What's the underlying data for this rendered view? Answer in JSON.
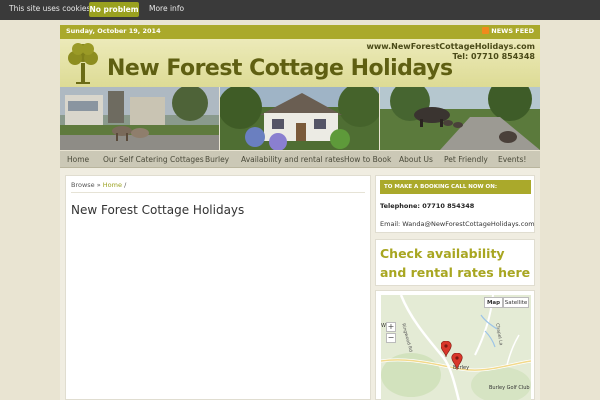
{
  "cookie_bar": {
    "message": "This site uses cookies",
    "accept_label": "No problem",
    "more_label": "More info"
  },
  "topbar": {
    "date": "Sunday, October 19, 2014",
    "feed_label": "NEWS FEED"
  },
  "header": {
    "url": "www.NewForestCottageHolidays.com",
    "tel": "Tel: 07710 854348",
    "title": "New Forest Cottage Holidays"
  },
  "nav": {
    "items": [
      "Home",
      "Our Self Catering Cottages",
      "Burley",
      "Availability and rental rates",
      "How to Book",
      "About Us",
      "Pet Friendly",
      "Events!"
    ]
  },
  "breadcrumb": {
    "prefix": "Browse »",
    "home": "Home",
    "suffix": "/"
  },
  "page": {
    "title": "New Forest Cottage Holidays"
  },
  "sidebar": {
    "booking_heading": "TO MAKE A BOOKING CALL NOW ON:",
    "telephone": "Telephone: 07710 854348",
    "email": "Email: Wanda@NewForestCottageHolidays.com",
    "check_link": "Check availability and rental rates here"
  },
  "map": {
    "type_map": "Map",
    "type_satellite": "Satellite",
    "zoom_in": "+",
    "zoom_out": "−",
    "labels": {
      "place": "Burley",
      "golf": "Burley Golf Club",
      "road1": "Ringwood Rd",
      "road2": "Chapel La",
      "edge": "W"
    }
  },
  "colors": {
    "accent": "#aaa92b",
    "link": "#a8a621",
    "cookie_bar": "#3a3a3a"
  }
}
